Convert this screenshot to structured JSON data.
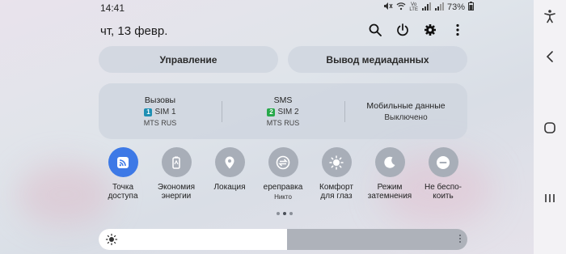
{
  "status_bar": {
    "time": "14:41",
    "battery": "73%"
  },
  "header": {
    "date": "чт, 13 февр.",
    "icons": [
      "search-icon",
      "power-icon",
      "gear-icon",
      "more-vert-icon"
    ]
  },
  "buttons": {
    "manage": "Управление",
    "media_output": "Вывод медиаданных"
  },
  "sim_panel": {
    "calls": {
      "title": "Вызовы",
      "sim_num": "1",
      "sim": "SIM 1",
      "operator": "MTS RUS",
      "badge_color": "#1f8fb3"
    },
    "sms": {
      "title": "SMS",
      "sim_num": "2",
      "sim": "SIM 2",
      "operator": "MTS RUS",
      "badge_color": "#27a84a"
    },
    "mobile_data": {
      "title": "Мобильные данные",
      "status": "Выключено"
    }
  },
  "tiles": [
    {
      "label": "Точка\nдоступа",
      "icon": "hotspot-icon",
      "active": true
    },
    {
      "label": "Экономия\nэнергии",
      "icon": "power-saving-icon",
      "active": false
    },
    {
      "label": "Локация",
      "icon": "location-icon",
      "active": false
    },
    {
      "label": "ереправка",
      "sublabel": "Никто",
      "icon": "quick-share-icon",
      "active": false
    },
    {
      "label": "Комфорт\nдля глаз",
      "icon": "eye-comfort-icon",
      "active": false
    },
    {
      "label": "Режим\nзатемнения",
      "icon": "dark-mode-icon",
      "active": false
    },
    {
      "label": "Не беспо-\nкоить",
      "icon": "do-not-disturb-icon",
      "active": false
    }
  ],
  "pager": {
    "pages": 3,
    "current": 1
  },
  "brightness": {
    "level": 0.51
  },
  "nav_bar": [
    "accessibility-icon",
    "back-icon",
    "home-icon",
    "recents-icon"
  ],
  "colors": {
    "accent": "#3d79e6",
    "tile_inactive": "#a8aeb8"
  }
}
